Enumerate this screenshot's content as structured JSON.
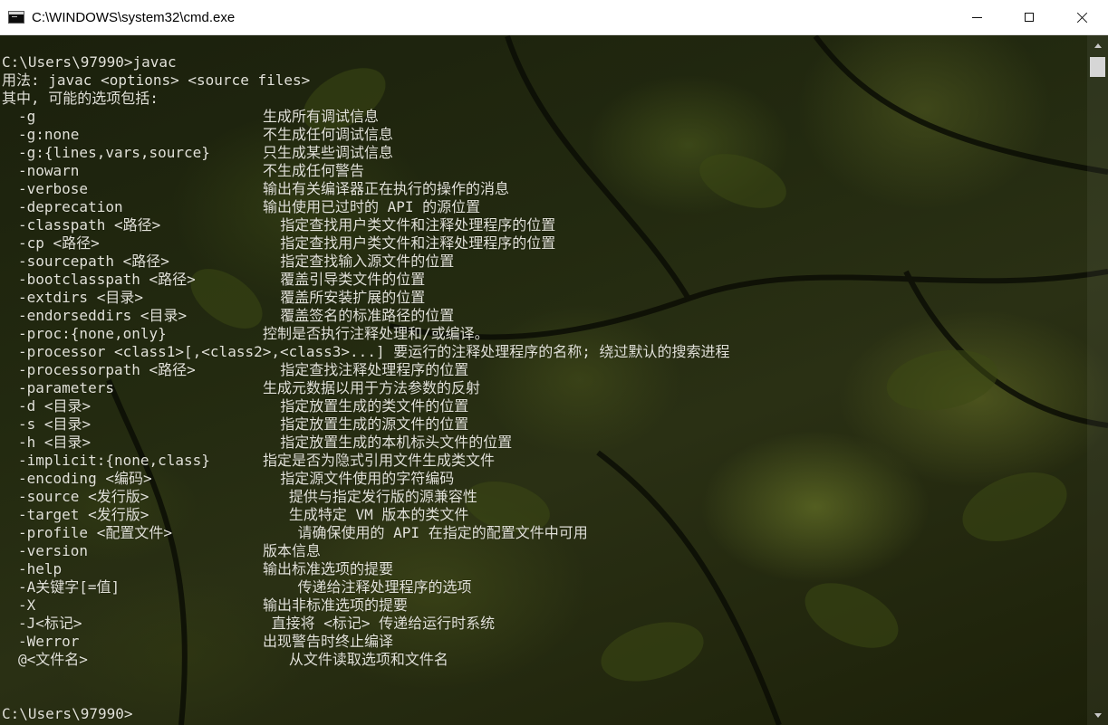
{
  "window": {
    "title": "C:\\WINDOWS\\system32\\cmd.exe",
    "icon": "console-icon",
    "controls": {
      "minimize": "minimize-icon",
      "maximize": "maximize-icon",
      "close": "close-icon"
    }
  },
  "console": {
    "prompt_line": "C:\\Users\\97990>javac",
    "usage_line": "用法: javac <options> <source files>",
    "options_header": "其中, 可能的选项包括:",
    "options": [
      {
        "opt": "-g",
        "desc": "生成所有调试信息"
      },
      {
        "opt": "-g:none",
        "desc": "不生成任何调试信息"
      },
      {
        "opt": "-g:{lines,vars,source}",
        "desc": "只生成某些调试信息"
      },
      {
        "opt": "-nowarn",
        "desc": "不生成任何警告"
      },
      {
        "opt": "-verbose",
        "desc": "输出有关编译器正在执行的操作的消息"
      },
      {
        "opt": "-deprecation",
        "desc": "输出使用已过时的 API 的源位置"
      },
      {
        "opt": "-classpath <路径>",
        "desc": "  指定查找用户类文件和注释处理程序的位置"
      },
      {
        "opt": "-cp <路径>",
        "desc": "  指定查找用户类文件和注释处理程序的位置"
      },
      {
        "opt": "-sourcepath <路径>",
        "desc": "  指定查找输入源文件的位置"
      },
      {
        "opt": "-bootclasspath <路径>",
        "desc": "  覆盖引导类文件的位置"
      },
      {
        "opt": "-extdirs <目录>",
        "desc": "  覆盖所安装扩展的位置"
      },
      {
        "opt": "-endorseddirs <目录>",
        "desc": "  覆盖签名的标准路径的位置"
      },
      {
        "opt": "-proc:{none,only}",
        "desc": "控制是否执行注释处理和/或编译。"
      },
      {
        "opt": "-processor <class1>[,<class2>,<class3>...]",
        "desc": " 要运行的注释处理程序的名称; 绕过默认的搜索进程",
        "wide": true
      },
      {
        "opt": "-processorpath <路径>",
        "desc": "  指定查找注释处理程序的位置"
      },
      {
        "opt": "-parameters",
        "desc": "生成元数据以用于方法参数的反射"
      },
      {
        "opt": "-d <目录>",
        "desc": "  指定放置生成的类文件的位置"
      },
      {
        "opt": "-s <目录>",
        "desc": "  指定放置生成的源文件的位置"
      },
      {
        "opt": "-h <目录>",
        "desc": "  指定放置生成的本机标头文件的位置"
      },
      {
        "opt": "-implicit:{none,class}",
        "desc": "指定是否为隐式引用文件生成类文件"
      },
      {
        "opt": "-encoding <编码>",
        "desc": "  指定源文件使用的字符编码"
      },
      {
        "opt": "-source <发行版>",
        "desc": "   提供与指定发行版的源兼容性"
      },
      {
        "opt": "-target <发行版>",
        "desc": "   生成特定 VM 版本的类文件"
      },
      {
        "opt": "-profile <配置文件>",
        "desc": "    请确保使用的 API 在指定的配置文件中可用"
      },
      {
        "opt": "-version",
        "desc": "版本信息"
      },
      {
        "opt": "-help",
        "desc": "输出标准选项的提要"
      },
      {
        "opt": "-A关键字[=值]",
        "desc": "    传递给注释处理程序的选项"
      },
      {
        "opt": "-X",
        "desc": "输出非标准选项的提要"
      },
      {
        "opt": "-J<标记>",
        "desc": " 直接将 <标记> 传递给运行时系统"
      },
      {
        "opt": "-Werror",
        "desc": "出现警告时终止编译"
      },
      {
        "opt": "@<文件名>",
        "desc": "   从文件读取选项和文件名"
      }
    ],
    "final_prompt": "C:\\Users\\97990>"
  },
  "scrollbar": {
    "up": "scroll-up-arrow-icon",
    "down": "scroll-down-arrow-icon"
  }
}
